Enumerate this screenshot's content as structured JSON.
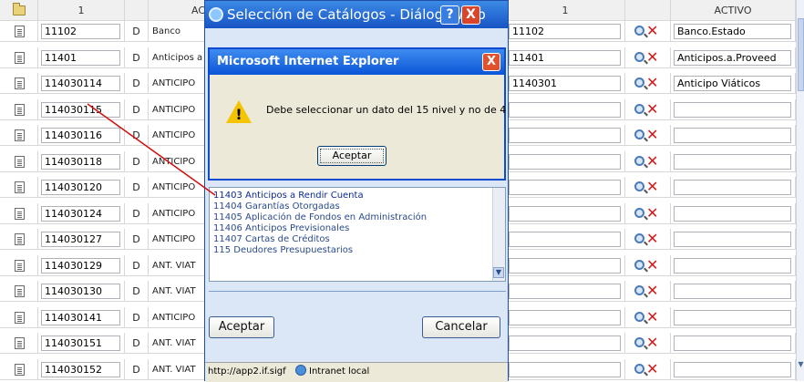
{
  "grid": {
    "headers": {
      "code": "1",
      "activo": "AC",
      "code2": "1",
      "activo2": "ACTIVO"
    },
    "rows": [
      {
        "code": "11102",
        "d": "D",
        "act": "Banco",
        "code2": "11102",
        "act2": "Banco.Estado"
      },
      {
        "code": "11401",
        "d": "D",
        "act": "Anticipos a",
        "code2": "11401",
        "act2": "Anticipos.a.Proveed"
      },
      {
        "code": "114030114",
        "d": "D",
        "act": "ANTICIPO",
        "code2": "1140301",
        "act2": "Anticipo Viáticos"
      },
      {
        "code": "114030115",
        "d": "D",
        "act": "ANTICIPO",
        "code2": "",
        "act2": ""
      },
      {
        "code": "114030116",
        "d": "D",
        "act": "ANTICIPO",
        "code2": "",
        "act2": ""
      },
      {
        "code": "114030118",
        "d": "D",
        "act": "ANTICIPO",
        "code2": "",
        "act2": ""
      },
      {
        "code": "114030120",
        "d": "D",
        "act": "ANTICIPO",
        "code2": "",
        "act2": ""
      },
      {
        "code": "114030124",
        "d": "D",
        "act": "ANTICIPO",
        "code2": "",
        "act2": ""
      },
      {
        "code": "114030127",
        "d": "D",
        "act": "ANTICIPO",
        "code2": "",
        "act2": ""
      },
      {
        "code": "114030129",
        "d": "D",
        "act": "ANT. VIAT",
        "code2": "",
        "act2": ""
      },
      {
        "code": "114030130",
        "d": "D",
        "act": "ANT. VIAT",
        "code2": "",
        "act2": ""
      },
      {
        "code": "114030141",
        "d": "D",
        "act": "ANTICIPO",
        "code2": "",
        "act2": ""
      },
      {
        "code": "114030151",
        "d": "D",
        "act": "ANT. VIAT",
        "code2": "",
        "act2": ""
      },
      {
        "code": "114030152",
        "d": "D",
        "act": "ANT. VIAT",
        "code2": "",
        "act2": ""
      }
    ]
  },
  "catalog_dialog": {
    "title": "Selección de Catálogos - Diálogo Web",
    "help_label": "?",
    "close_label": "X",
    "items": [
      "11403 Anticipos a Rendir Cuenta",
      "11404 Garantías Otorgadas",
      "11405 Aplicación de Fondos en Administración",
      "11406 Anticipos Previsionales",
      "11407 Cartas de Créditos",
      "115 Deudores Presupuestarios"
    ],
    "accept_label": "Aceptar",
    "cancel_label": "Cancelar",
    "status_url": "http://app2.if.sigf",
    "status_zone": "Intranet local"
  },
  "message_box": {
    "title": "Microsoft Internet Explorer",
    "close_label": "X",
    "message": "Debe seleccionar un dato del 15 nivel y no de 4",
    "ok_label": "Aceptar"
  },
  "icons": {
    "header": "folder-icon",
    "row": "document-icon",
    "delete": "search-delete-icon",
    "warning": "warning-icon"
  },
  "colors": {
    "titlebar": "#1754c4",
    "warning": "#f5c400",
    "delete": "#d21a1a",
    "arrow": "#d01010"
  }
}
